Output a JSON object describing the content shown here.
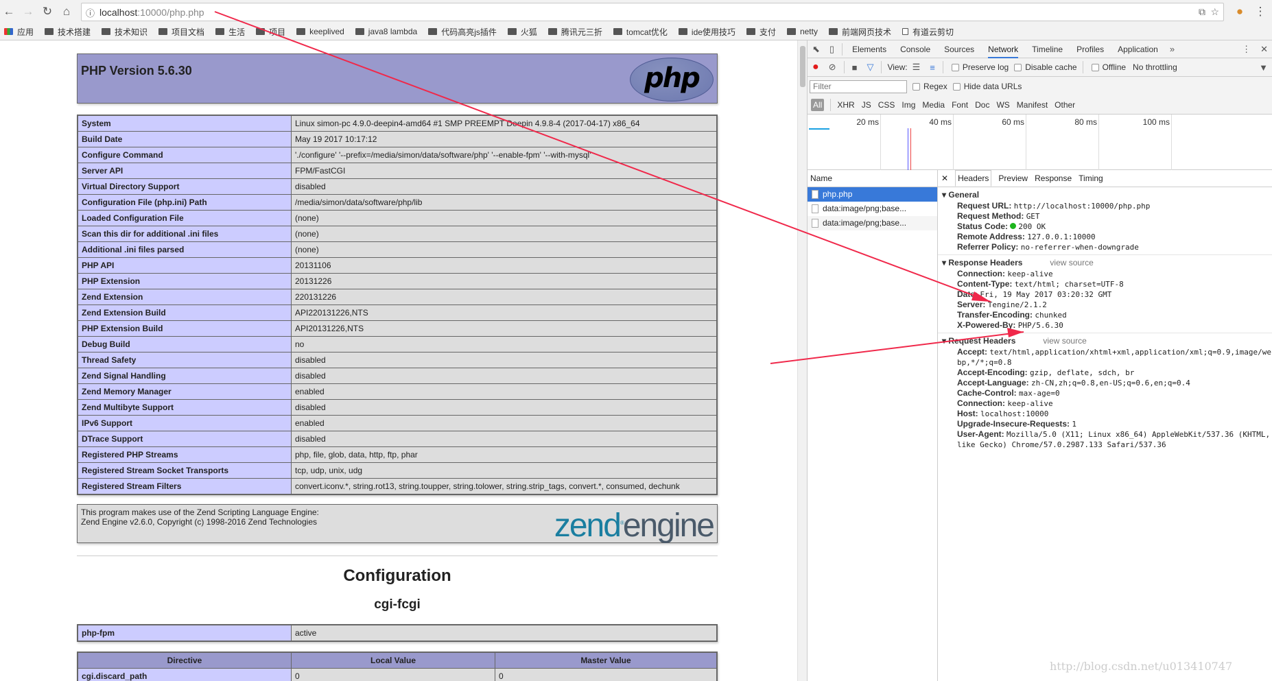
{
  "browser": {
    "url_host": "localhost",
    "url_rest": ":10000/php.php",
    "bookmarks": [
      "应用",
      "技术搭建",
      "技术知识",
      "项目文档",
      "生活",
      "项目",
      "keeplived",
      "java8 lambda",
      "代码高亮js插件",
      "火狐",
      "腾讯元三折",
      "tomcat优化",
      "ide使用技巧",
      "支付",
      "netty",
      "前端网页技术",
      "有道云剪切"
    ]
  },
  "phpinfo": {
    "title": "PHP Version 5.6.30",
    "logo": "php",
    "rows": [
      [
        "System",
        "Linux simon-pc 4.9.0-deepin4-amd64 #1 SMP PREEMPT Deepin 4.9.8-4 (2017-04-17) x86_64"
      ],
      [
        "Build Date",
        "May 19 2017 10:17:12"
      ],
      [
        "Configure Command",
        "'./configure' '--prefix=/media/simon/data/software/php' '--enable-fpm' '--with-mysql'"
      ],
      [
        "Server API",
        "FPM/FastCGI"
      ],
      [
        "Virtual Directory Support",
        "disabled"
      ],
      [
        "Configuration File (php.ini) Path",
        "/media/simon/data/software/php/lib"
      ],
      [
        "Loaded Configuration File",
        "(none)"
      ],
      [
        "Scan this dir for additional .ini files",
        "(none)"
      ],
      [
        "Additional .ini files parsed",
        "(none)"
      ],
      [
        "PHP API",
        "20131106"
      ],
      [
        "PHP Extension",
        "20131226"
      ],
      [
        "Zend Extension",
        "220131226"
      ],
      [
        "Zend Extension Build",
        "API220131226,NTS"
      ],
      [
        "PHP Extension Build",
        "API20131226,NTS"
      ],
      [
        "Debug Build",
        "no"
      ],
      [
        "Thread Safety",
        "disabled"
      ],
      [
        "Zend Signal Handling",
        "disabled"
      ],
      [
        "Zend Memory Manager",
        "enabled"
      ],
      [
        "Zend Multibyte Support",
        "disabled"
      ],
      [
        "IPv6 Support",
        "enabled"
      ],
      [
        "DTrace Support",
        "disabled"
      ],
      [
        "Registered PHP Streams",
        "php, file, glob, data, http, ftp, phar"
      ],
      [
        "Registered Stream Socket Transports",
        "tcp, udp, unix, udg"
      ],
      [
        "Registered Stream Filters",
        "convert.iconv.*, string.rot13, string.toupper, string.tolower, string.strip_tags, convert.*, consumed, dechunk"
      ]
    ],
    "zend_line1": "This program makes use of the Zend Scripting Language Engine:",
    "zend_line2": "Zend Engine v2.6.0, Copyright (c) 1998-2016 Zend Technologies",
    "zend_logo_a": "zend",
    "zend_logo_b": "engine",
    "config_title": "Configuration",
    "module_title": "cgi-fcgi",
    "module_row": [
      "php-fpm",
      "active"
    ],
    "dir_headers": [
      "Directive",
      "Local Value",
      "Master Value"
    ],
    "dir_rows": [
      [
        "cgi.discard_path",
        "0",
        "0"
      ]
    ]
  },
  "devtools": {
    "tabs": [
      "Elements",
      "Console",
      "Sources",
      "Network",
      "Timeline",
      "Profiles",
      "Application"
    ],
    "active_tab": "Network",
    "toolbar": {
      "view": "View:",
      "preserve_log": "Preserve log",
      "disable_cache": "Disable cache",
      "offline": "Offline",
      "throttling": "No throttling"
    },
    "filter": {
      "placeholder": "Filter",
      "regex": "Regex",
      "hide_data": "Hide data URLs"
    },
    "types": [
      "All",
      "XHR",
      "JS",
      "CSS",
      "Img",
      "Media",
      "Font",
      "Doc",
      "WS",
      "Manifest",
      "Other"
    ],
    "timeline_ticks": [
      "20 ms",
      "40 ms",
      "60 ms",
      "80 ms",
      "100 ms"
    ],
    "name_header": "Name",
    "requests": [
      "php.php",
      "data:image/png;base...",
      "data:image/png;base..."
    ],
    "detail_tabs": [
      "Headers",
      "Preview",
      "Response",
      "Timing"
    ],
    "general_title": "General",
    "general": [
      [
        "Request URL:",
        "http://localhost:10000/php.php"
      ],
      [
        "Request Method:",
        "GET"
      ],
      [
        "Status Code:",
        "200 OK"
      ],
      [
        "Remote Address:",
        "127.0.0.1:10000"
      ],
      [
        "Referrer Policy:",
        "no-referrer-when-downgrade"
      ]
    ],
    "response_title": "Response Headers",
    "view_source": "view source",
    "response": [
      [
        "Connection:",
        "keep-alive"
      ],
      [
        "Content-Type:",
        "text/html; charset=UTF-8"
      ],
      [
        "Date:",
        "Fri, 19 May 2017 03:20:32 GMT"
      ],
      [
        "Server:",
        "Tengine/2.1.2"
      ],
      [
        "Transfer-Encoding:",
        "chunked"
      ],
      [
        "X-Powered-By:",
        "PHP/5.6.30"
      ]
    ],
    "request_title": "Request Headers",
    "request": [
      [
        "Accept:",
        "text/html,application/xhtml+xml,application/xml;q=0.9,image/webp,*/*;q=0.8"
      ],
      [
        "Accept-Encoding:",
        "gzip, deflate, sdch, br"
      ],
      [
        "Accept-Language:",
        "zh-CN,zh;q=0.8,en-US;q=0.6,en;q=0.4"
      ],
      [
        "Cache-Control:",
        "max-age=0"
      ],
      [
        "Connection:",
        "keep-alive"
      ],
      [
        "Host:",
        "localhost:10000"
      ],
      [
        "Upgrade-Insecure-Requests:",
        "1"
      ],
      [
        "User-Agent:",
        "Mozilla/5.0 (X11; Linux x86_64) AppleWebKit/537.36 (KHTML, like Gecko) Chrome/57.0.2987.133 Safari/537.36"
      ]
    ]
  },
  "annotation_color": "#f0284a",
  "watermark": "http://blog.csdn.net/u013410747"
}
